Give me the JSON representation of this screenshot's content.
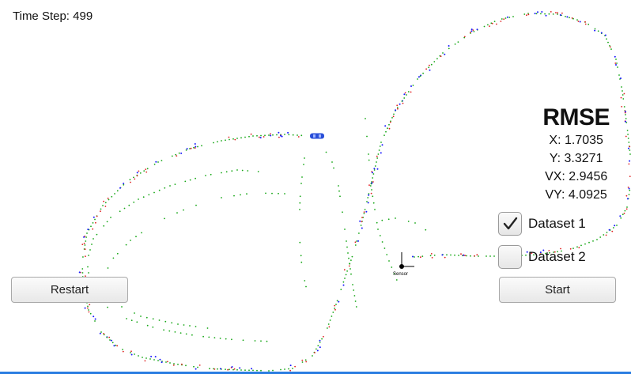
{
  "time_step": {
    "label": "Time Step: 499"
  },
  "rmse": {
    "title": "RMSE",
    "x": "X: 1.7035",
    "y": "Y: 3.3271",
    "vx": "VX: 2.9456",
    "vy": "VY: 4.0925"
  },
  "buttons": {
    "restart": "Restart",
    "start": "Start"
  },
  "datasets": [
    {
      "label": "Dataset 1",
      "checked": true
    },
    {
      "label": "Dataset 2",
      "checked": false
    }
  ],
  "sensor": {
    "label": "Sensor"
  },
  "colors": {
    "lidar": "#e02020",
    "radar": "#1a1aff",
    "estimate": "#18a818",
    "car": "#2a4fd8",
    "accent": "#2a7de1"
  }
}
